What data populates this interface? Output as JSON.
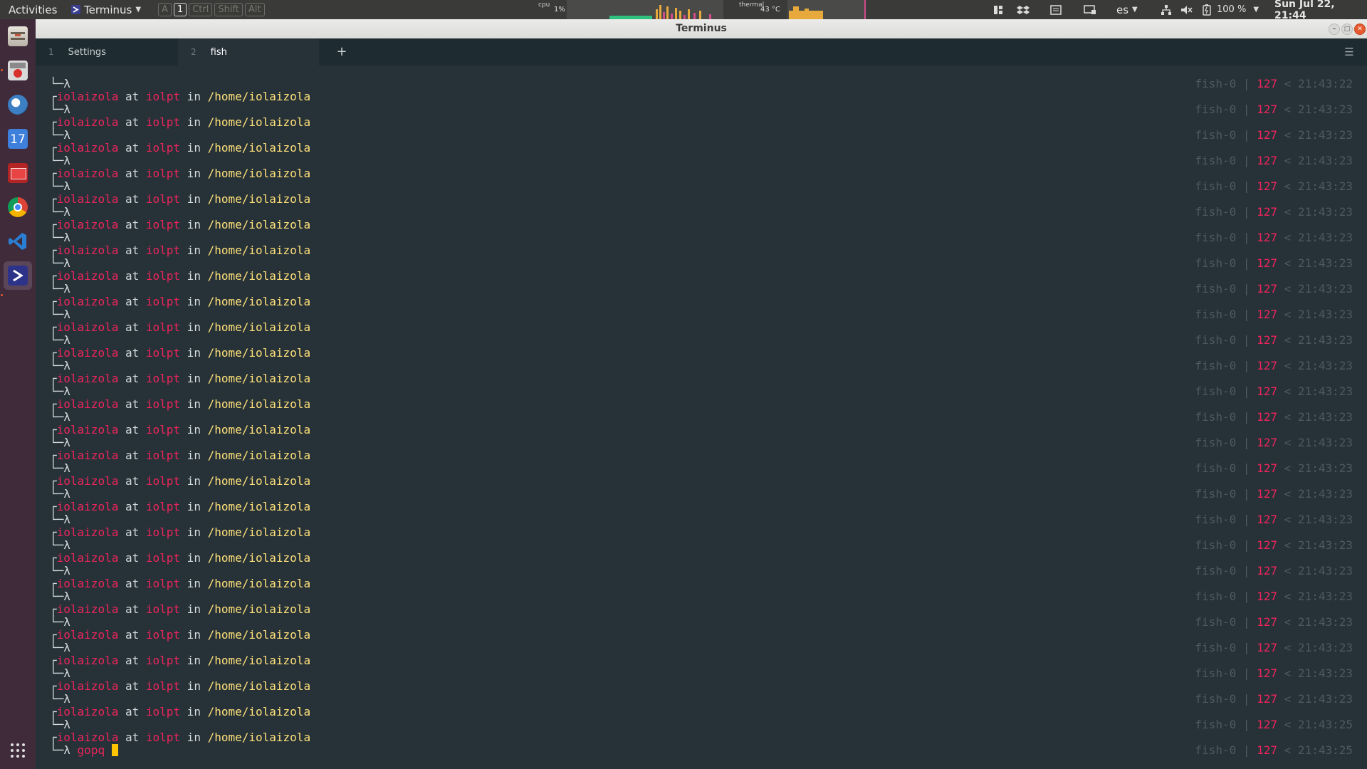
{
  "topbar": {
    "activities": "Activities",
    "app_menu": "Terminus",
    "keys": [
      "A",
      "1",
      "Ctrl",
      "Shift",
      "Alt"
    ],
    "active_key_index": 1,
    "cpu_label": "cpu",
    "cpu_value": "1%",
    "thermal_label": "thermal",
    "thermal_value": "43 °C",
    "keyboard_layout": "es",
    "battery": "100 %",
    "datetime": "Sun Jul 22, 21:44"
  },
  "window": {
    "title": "Terminus",
    "tabs": [
      {
        "num": "1",
        "label": "Settings",
        "active": false
      },
      {
        "num": "2",
        "label": "fish",
        "active": true
      }
    ],
    "add_tab_glyph": "+",
    "settings_glyph": "☰"
  },
  "dock": {
    "items": [
      "files",
      "archive-manager",
      "thunderbird",
      "calendar",
      "screenshot-tool",
      "chrome",
      "vscode",
      "terminus"
    ],
    "calendar_day": "17",
    "active_index": 7,
    "apps_grid_icon": "apps-grid-icon"
  },
  "terminal": {
    "prompt_prefix": "└─",
    "lambda": "λ",
    "user": "iolaizola",
    "at": "at",
    "host": "iolpt",
    "in": "in",
    "path": "/home/iolaizola",
    "right_prompt": {
      "shell": "fish-0",
      "sep": "|",
      "code": "127",
      "lt": "<"
    },
    "first_time": "21:43:22",
    "repeat_time": "21:43:23",
    "late_time": "21:43:25",
    "prompt_count": 27,
    "current_command": "gopq",
    "cursor_color": "#ffc400"
  },
  "colors": {
    "terminal_bg": "#263238",
    "accent_red": "#f0245c",
    "path_yellow": "#ffe07a",
    "dim_gray": "#4d5a60"
  }
}
